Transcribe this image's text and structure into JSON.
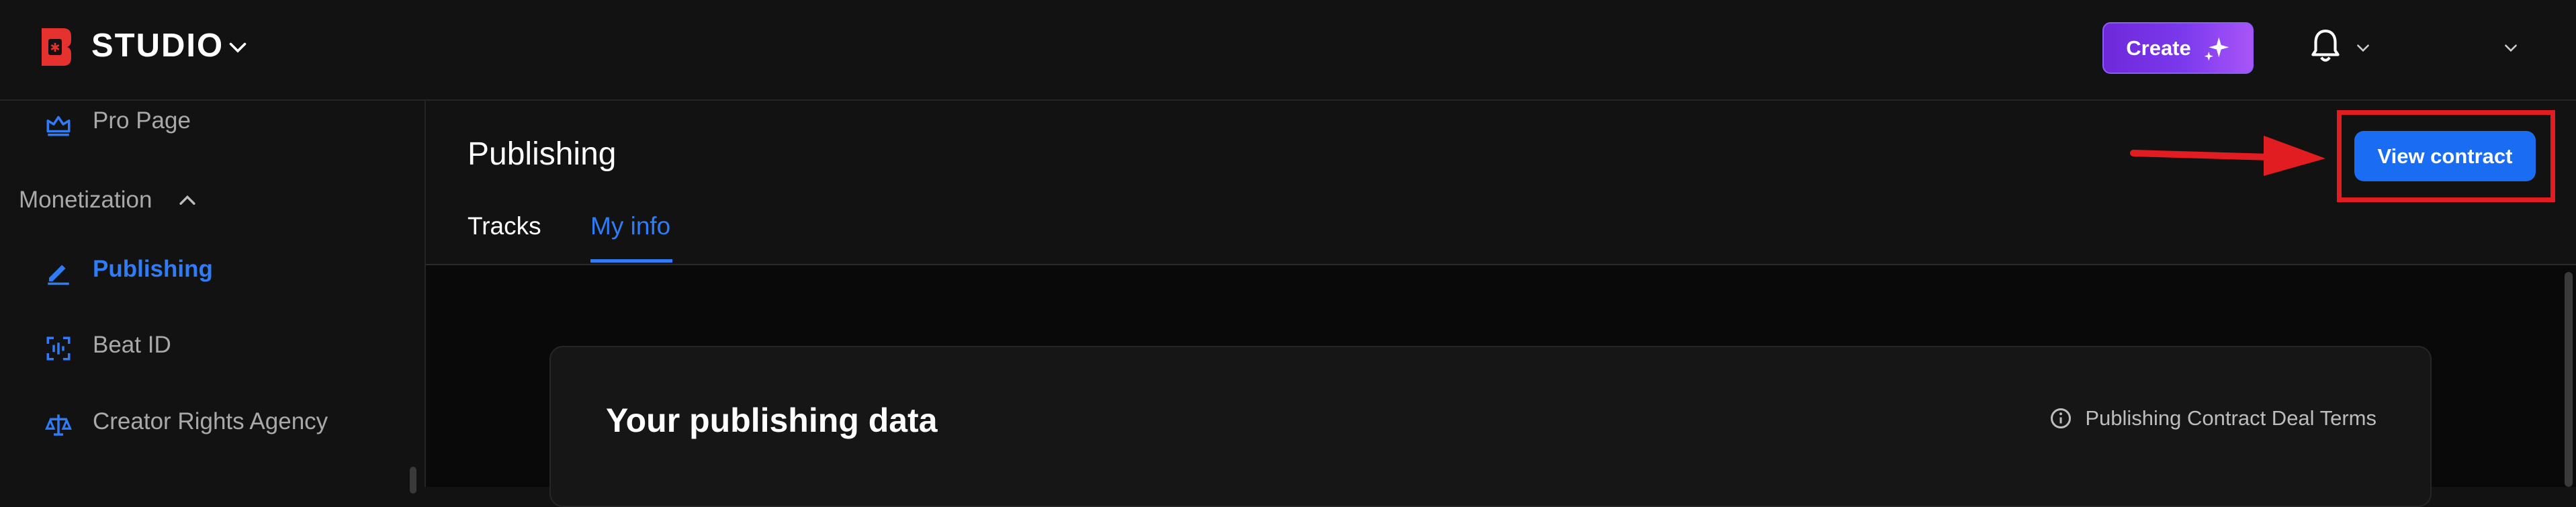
{
  "app": {
    "brand": "STUDIO",
    "create_label": "Create"
  },
  "sidebar": {
    "items_top": [
      {
        "label": "Pro Page",
        "icon": "crown-icon"
      }
    ],
    "section": {
      "label": "Monetization",
      "expanded": true
    },
    "items": [
      {
        "label": "Publishing",
        "icon": "pen-icon",
        "active": true
      },
      {
        "label": "Beat ID",
        "icon": "scan-icon",
        "active": false
      },
      {
        "label": "Creator Rights Agency",
        "icon": "scale-icon",
        "active": false
      }
    ]
  },
  "main": {
    "title": "Publishing",
    "tabs": [
      {
        "label": "Tracks",
        "active": false
      },
      {
        "label": "My info",
        "active": true
      }
    ],
    "view_contract_label": "View contract",
    "card": {
      "title": "Your publishing data",
      "link_label": "Publishing Contract Deal Terms"
    }
  },
  "colors": {
    "accent_blue": "#2f7cf6",
    "button_blue": "#1a6cf2",
    "create_purple": "#7c3aed",
    "highlight_red": "#e11d22",
    "background": "#121212"
  }
}
